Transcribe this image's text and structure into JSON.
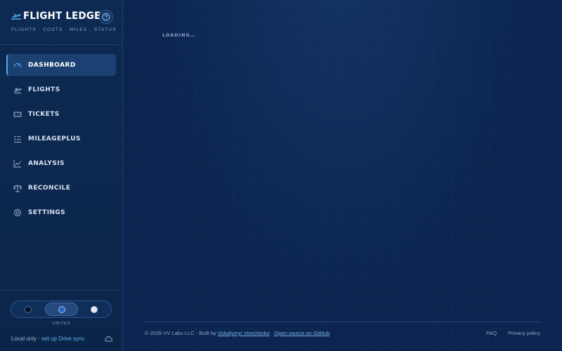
{
  "brand": {
    "title": "FLIGHT LEDGER",
    "subtitle": "FLIGHTS · COSTS · MILES · STATUS",
    "logo_icon": "plane-takeoff-icon",
    "help_icon": "help-circle-icon"
  },
  "nav": {
    "items": [
      {
        "label": "DASHBOARD",
        "icon": "gauge-icon",
        "active": true
      },
      {
        "label": "FLIGHTS",
        "icon": "plane-icon",
        "active": false
      },
      {
        "label": "TICKETS",
        "icon": "ticket-icon",
        "active": false
      },
      {
        "label": "MILEAGEPLUS",
        "icon": "checklist-icon",
        "active": false
      },
      {
        "label": "ANALYSIS",
        "icon": "line-chart-icon",
        "active": false
      },
      {
        "label": "RECONCILE",
        "icon": "scale-icon",
        "active": false
      },
      {
        "label": "SETTINGS",
        "icon": "gear-icon",
        "active": false
      }
    ]
  },
  "theme": {
    "selected_label": "UNITED",
    "options": [
      "dark",
      "united",
      "light"
    ]
  },
  "sync": {
    "prefix": "Local only · ",
    "link": "set up Drive sync",
    "icon": "cloud-icon"
  },
  "main": {
    "status": "LOADING…"
  },
  "footer": {
    "prefix": "© 2026 VV Labs LLC · Built by ",
    "author": "Volodymyr Vovchenko",
    "separator": " · ",
    "source_link": "Open source on GitHub",
    "faq": "FAQ",
    "privacy": "Privacy policy"
  },
  "colors": {
    "accent": "#4aa8e8",
    "background": "#0b2550",
    "sidebar": "#0d2a52"
  }
}
